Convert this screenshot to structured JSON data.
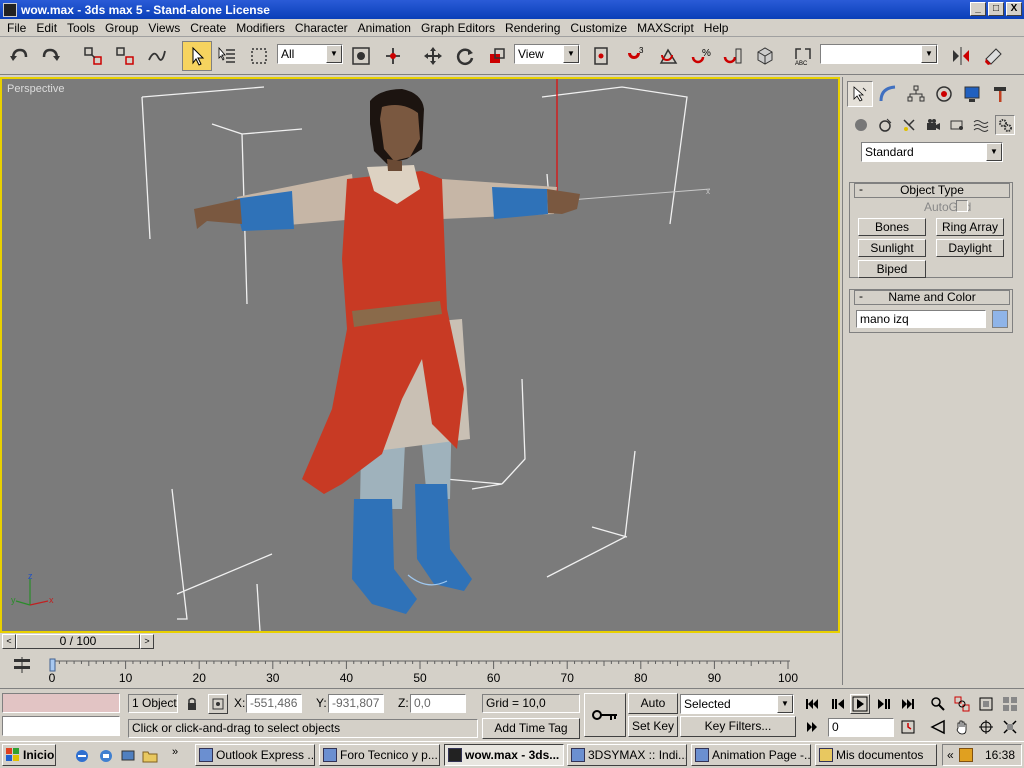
{
  "window": {
    "title": "wow.max - 3ds max 5 - Stand-alone License",
    "min": "_",
    "max": "□",
    "close": "X"
  },
  "menu": [
    "File",
    "Edit",
    "Tools",
    "Group",
    "Views",
    "Create",
    "Modifiers",
    "Character",
    "Animation",
    "Graph Editors",
    "Rendering",
    "Customize",
    "MAXScript",
    "Help"
  ],
  "toolbar": {
    "selection_filter": "All",
    "ref_coord": "View",
    "named_sel": ""
  },
  "viewport": {
    "label": "Perspective",
    "axis_x": "x",
    "axis_y": "y",
    "axis_z": "z"
  },
  "cmdpanel": {
    "category": "Standard",
    "object_type": {
      "title": "Object Type",
      "autogrid": "AutoGrid",
      "buttons": [
        "Bones",
        "Ring Array",
        "Sunlight",
        "Daylight",
        "Biped"
      ]
    },
    "name_color": {
      "title": "Name and Color",
      "name": "mano izq",
      "swatch": "#8fb4e8"
    }
  },
  "timeline": {
    "frame": "0 / 100",
    "ticks": [
      "0",
      "10",
      "20",
      "30",
      "40",
      "50",
      "60",
      "70",
      "80",
      "90",
      "100"
    ]
  },
  "status": {
    "selection": "1 Object",
    "x_label": "X:",
    "x": "-551,486",
    "y_label": "Y:",
    "y": "-931,807",
    "z_label": "Z:",
    "z": "0,0",
    "grid": "Grid = 10,0",
    "add_time_tag": "Add Time Tag",
    "prompt": "Click or click-and-drag to select objects",
    "auto_key": "Auto Key",
    "set_key": "Set Key",
    "key_mode": "Selected",
    "key_filters": "Key Filters...",
    "current_frame": "0"
  },
  "taskbar": {
    "start": "Inicio",
    "tasks": [
      "Outlook Express ...",
      "Foro Tecnico y p...",
      "wow.max - 3ds...",
      "3DSYMAX :: Indi...",
      "Animation Page -...",
      "Mis documentos"
    ],
    "clock": "16:38"
  },
  "colors": {
    "viewport_bg": "#7b7b7b",
    "active_border": "#e8d000",
    "tunic": "#c83a24",
    "boots": "#2f72b8"
  }
}
